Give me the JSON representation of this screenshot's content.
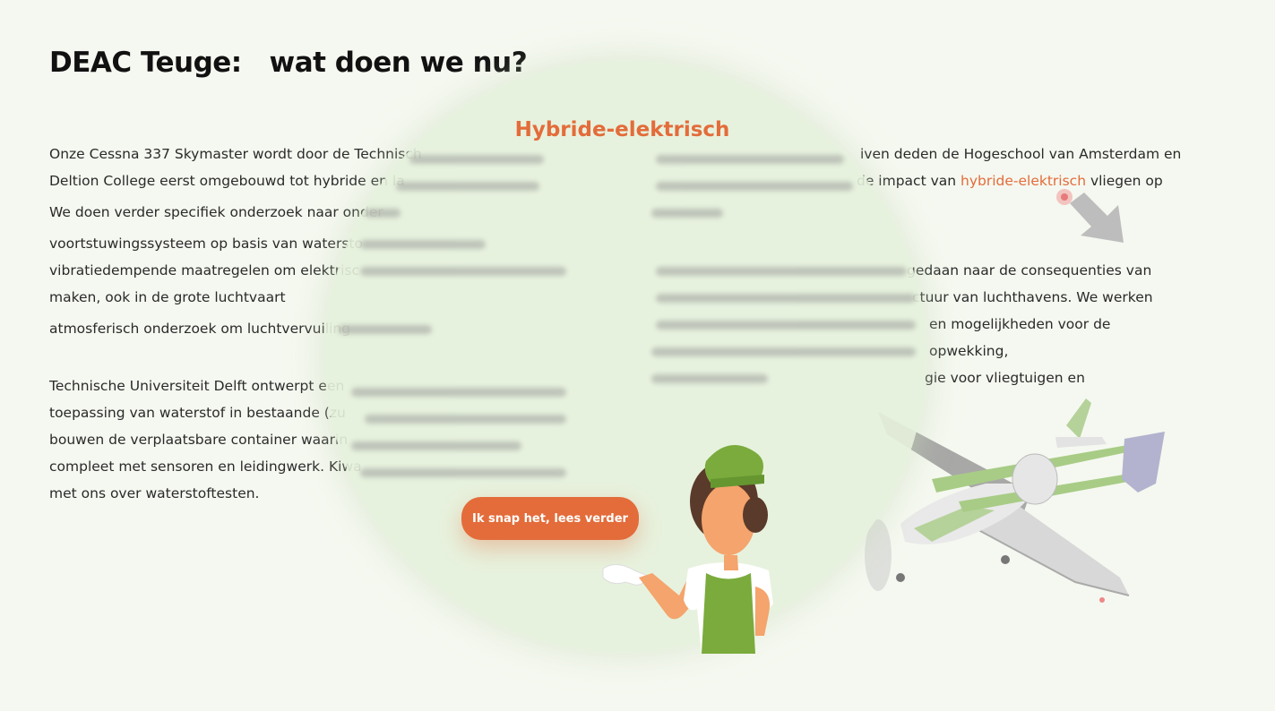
{
  "page": {
    "title": "DEAC Teuge:   wat doen we nu?"
  },
  "left_column": {
    "p1_l1": "Onze Cessna 337 Skymaster wordt door de Technisch",
    "p1_l2": "Deltion College eerst omgebouwd tot hybride en la",
    "p2": "We doen verder specifiek onderzoek naar onder",
    "b1": "voortstuwingssysteem op basis van watersto",
    "b2_l1": "vibratiedempende maatregelen om elektrisc",
    "b2_l2": "maken, ook in de grote luchtvaart",
    "b3": "atmosferisch onderzoek om luchtvervuiling",
    "p3_l1": "Technische Universiteit Delft ontwerpt een",
    "p3_l2": "toepassing van waterstof in bestaande (zu",
    "p3_l3": "bouwen de verplaatsbare container waarin",
    "p3_l4": "compleet met sensoren en leidingwerk. Kiwa",
    "p3_l5": "met ons over waterstoftesten."
  },
  "right_column": {
    "p1_l1": "iven deden de Hogeschool van Amsterdam en",
    "p1_l2_pre": "de impact van ",
    "p1_l2_link": "hybride-elektrisch",
    "p1_l2_post": " vliegen op",
    "p2_l1": "gedaan naar de consequenties van",
    "p2_l2": "ctuur van luchthavens. We werken",
    "p2_l3": "en mogelijkheden voor de opwekking,",
    "p2_l4": "gie voor vliegtuigen en"
  },
  "popup": {
    "title": "Hybride-elektrisch",
    "button_label": "Ik snap het, lees verder"
  },
  "colors": {
    "accent": "#e36c3a",
    "background": "#f5f8f0",
    "bubble": "#e6f1dc",
    "mascot_green": "#7aab3c"
  },
  "icons": {
    "pointer": "arrow-pointer-icon",
    "plane": "cessna-airplane-illustration",
    "mascot": "stewardess-mascot-illustration"
  }
}
